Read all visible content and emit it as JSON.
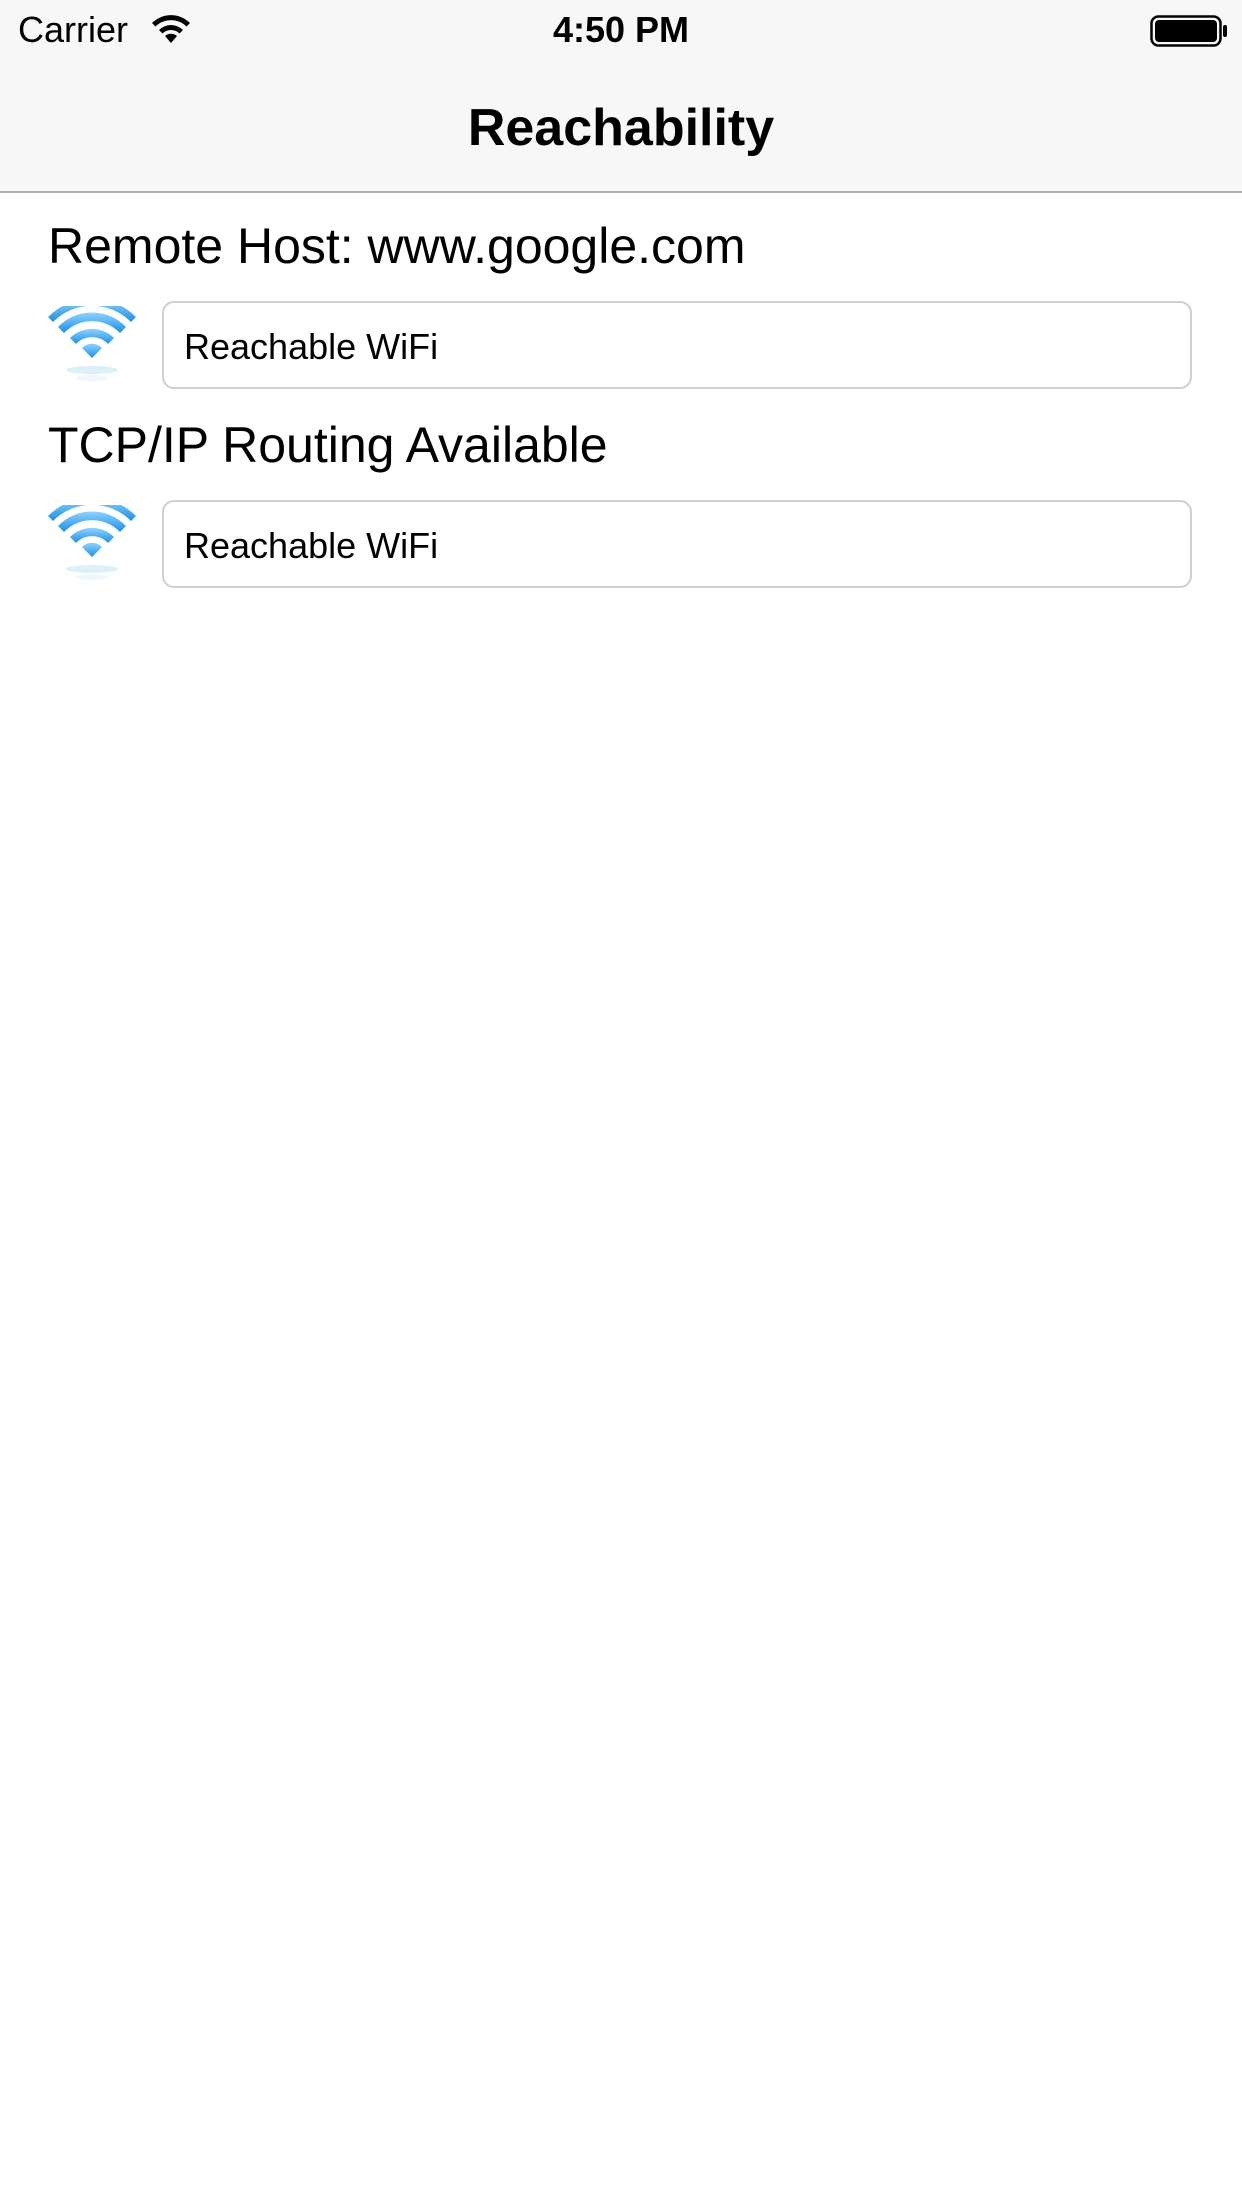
{
  "status_bar": {
    "carrier": "Carrier",
    "time": "4:50 PM",
    "wifi_icon": "wifi-signal-icon",
    "battery_icon": "battery-full-icon"
  },
  "nav": {
    "title": "Reachability"
  },
  "sections": [
    {
      "title": "Remote Host: www.google.com",
      "icon": "wifi-icon",
      "status": "Reachable WiFi"
    },
    {
      "title": "TCP/IP Routing Available",
      "icon": "wifi-icon",
      "status": "Reachable WiFi"
    }
  ],
  "colors": {
    "bar_background": "#f7f7f7",
    "field_border": "#cfcfcf",
    "wifi_blue": "#3fa9f5"
  }
}
